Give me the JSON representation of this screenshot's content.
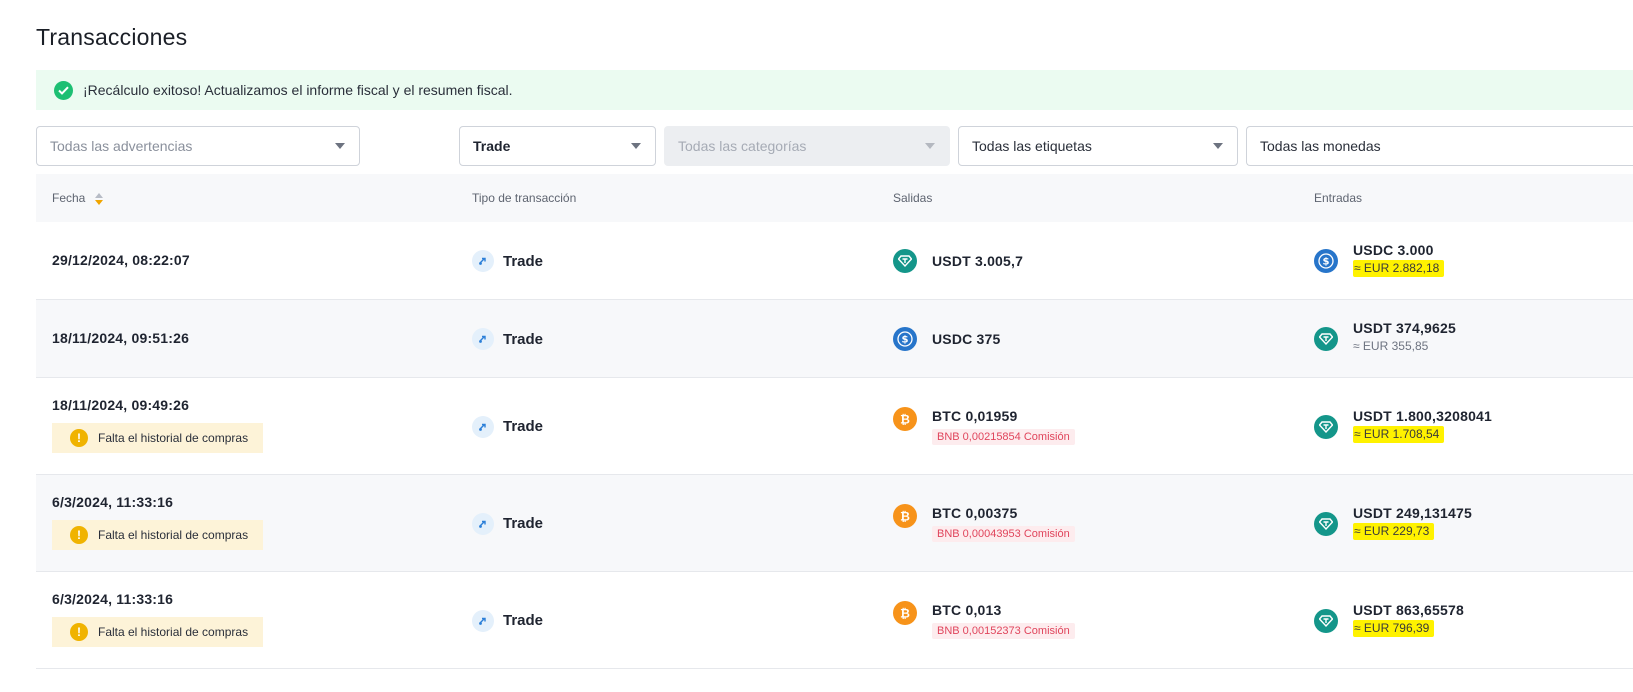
{
  "page": {
    "title": "Transacciones"
  },
  "banner": {
    "message": "¡Recálculo exitoso! Actualizamos el informe fiscal y el resumen fiscal."
  },
  "filters": {
    "warnings": "Todas las advertencias",
    "type": "Trade",
    "categories": "Todas las categorías",
    "tags": "Todas las etiquetas",
    "currencies": "Todas las monedas"
  },
  "columns": {
    "date": "Fecha",
    "type": "Tipo de transacción",
    "outputs": "Salidas",
    "inputs": "Entradas"
  },
  "rows": [
    {
      "date": "29/12/2024, 08:22:07",
      "warning": "",
      "type": "Trade",
      "out": {
        "coin": "usdt",
        "amount": "USDT 3.005,7",
        "fee": ""
      },
      "in": {
        "coin": "usdc",
        "amount": "USDC 3.000",
        "eur": "≈ EUR 2.882,18",
        "highlighted": true
      }
    },
    {
      "date": "18/11/2024, 09:51:26",
      "warning": "",
      "type": "Trade",
      "out": {
        "coin": "usdc",
        "amount": "USDC 375",
        "fee": ""
      },
      "in": {
        "coin": "usdt",
        "amount": "USDT 374,9625",
        "eur": "≈ EUR 355,85",
        "highlighted": false
      }
    },
    {
      "date": "18/11/2024, 09:49:26",
      "warning": "Falta el historial de compras",
      "type": "Trade",
      "out": {
        "coin": "btc",
        "amount": "BTC 0,01959",
        "fee": "BNB 0,00215854 Comisión"
      },
      "in": {
        "coin": "usdt",
        "amount": "USDT 1.800,3208041",
        "eur": "≈ EUR 1.708,54",
        "highlighted": true
      }
    },
    {
      "date": "6/3/2024, 11:33:16",
      "warning": "Falta el historial de compras",
      "type": "Trade",
      "out": {
        "coin": "btc",
        "amount": "BTC 0,00375",
        "fee": "BNB 0,00043953 Comisión"
      },
      "in": {
        "coin": "usdt",
        "amount": "USDT 249,131475",
        "eur": "≈ EUR 229,73",
        "highlighted": true
      }
    },
    {
      "date": "6/3/2024, 11:33:16",
      "warning": "Falta el historial de compras",
      "type": "Trade",
      "out": {
        "coin": "btc",
        "amount": "BTC 0,013",
        "fee": "BNB 0,00152373 Comisión"
      },
      "in": {
        "coin": "usdt",
        "amount": "USDT 863,65578",
        "eur": "≈ EUR 796,39",
        "highlighted": true
      }
    }
  ]
}
